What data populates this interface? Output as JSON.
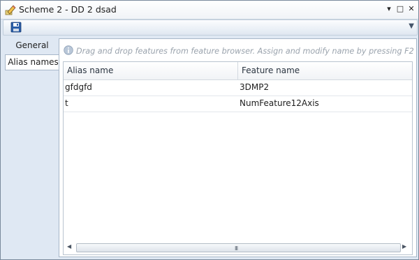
{
  "window": {
    "title": "Scheme 2 - DD 2 dsad",
    "icon": "scheme-pencil-icon",
    "controls": {
      "pin": "▾",
      "maximize": "□",
      "close": "✕"
    }
  },
  "toolbar": {
    "save_icon": "save-icon",
    "overflow": "▼"
  },
  "tabs": [
    {
      "label": "General",
      "active": false
    },
    {
      "label": "Alias names",
      "active": true
    }
  ],
  "hint": "Drag and drop features from feature browser. Assign and modify name by pressing F2",
  "grid": {
    "columns": [
      "Alias name",
      "Feature name"
    ],
    "rows": [
      {
        "alias": "gfdgfd",
        "feature": "3DMP2"
      },
      {
        "alias": "t",
        "feature": "NumFeature12Axis"
      }
    ],
    "scroll": {
      "left": "◀",
      "right": "▶",
      "grip": "III"
    }
  },
  "colors": {
    "accent": "#2a5ea8",
    "frame": "#dfe8f3",
    "border": "#a7b7c9"
  }
}
